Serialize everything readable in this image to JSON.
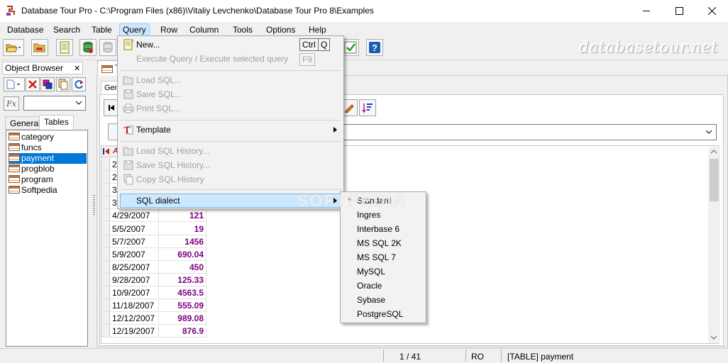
{
  "window": {
    "title": "Database Tour Pro - C:\\Program Files (x86)\\Vitaliy Levchenko\\Database Tour Pro 8\\Examples",
    "icon": "database-tour-app-icon"
  },
  "menubar": {
    "items": [
      "Database",
      "Search",
      "Table",
      "Query",
      "Row",
      "Column",
      "Tools",
      "Options",
      "Help"
    ],
    "active": "Query"
  },
  "toolbar": {
    "watermark": "databasetour.net"
  },
  "object_browser": {
    "title": "Object Browser",
    "tabs": [
      "General",
      "Tables"
    ],
    "selected_tab": "Tables",
    "filter_label": "Fx",
    "tables": [
      "category",
      "funcs",
      "payment",
      "progblob",
      "program",
      "Softpedia"
    ],
    "selected_table": "payment"
  },
  "document_tab": {
    "label": "T",
    "inner_tab_label": "Gene"
  },
  "grid": {
    "header_col_label": "A",
    "rows": [
      {
        "date": "2/",
        "amount": ""
      },
      {
        "date": "2/",
        "amount": ""
      },
      {
        "date": "3/",
        "amount": ""
      },
      {
        "date": "3/",
        "amount": ""
      },
      {
        "date": "4/29/2007",
        "amount": "121"
      },
      {
        "date": "5/5/2007",
        "amount": "19"
      },
      {
        "date": "5/7/2007",
        "amount": "1456"
      },
      {
        "date": "5/9/2007",
        "amount": "690.04"
      },
      {
        "date": "8/25/2007",
        "amount": "450"
      },
      {
        "date": "9/28/2007",
        "amount": "125.33"
      },
      {
        "date": "10/9/2007",
        "amount": "4563.5"
      },
      {
        "date": "11/18/2007",
        "amount": "555.09"
      },
      {
        "date": "12/12/2007",
        "amount": "989.08"
      },
      {
        "date": "12/19/2007",
        "amount": "876.9"
      }
    ],
    "amount_color": "#800080"
  },
  "query_menu": {
    "new": {
      "label": "New...",
      "shortcut_keys": [
        "Ctrl",
        "Q"
      ]
    },
    "execute": {
      "label": "Execute Query / Execute selected query",
      "shortcut": "F9",
      "enabled": false
    },
    "load_sql": {
      "label": "Load SQL...",
      "enabled": false
    },
    "save_sql": {
      "label": "Save SQL...",
      "enabled": false
    },
    "print_sql": {
      "label": "Print SQL...",
      "enabled": false
    },
    "template": {
      "label": "Template",
      "has_submenu": true
    },
    "load_history": {
      "label": "Load SQL History...",
      "enabled": false
    },
    "save_history": {
      "label": "Save SQL History...",
      "enabled": false
    },
    "copy_history": {
      "label": "Copy SQL History",
      "enabled": false
    },
    "sql_dialect": {
      "label": "SQL dialect",
      "has_submenu": true,
      "highlighted": true
    }
  },
  "dialect_menu": {
    "items": [
      "Standard",
      "Ingres",
      "Interbase 6",
      "MS SQL 2K",
      "MS SQL 7",
      "MySQL",
      "Oracle",
      "Sybase",
      "PostgreSQL"
    ],
    "selected": "Standard"
  },
  "statusbar": {
    "record_position": "1 / 41",
    "mode": "RO",
    "object": "[TABLE] payment"
  },
  "overlay_watermark": "SOFTPEDIA"
}
